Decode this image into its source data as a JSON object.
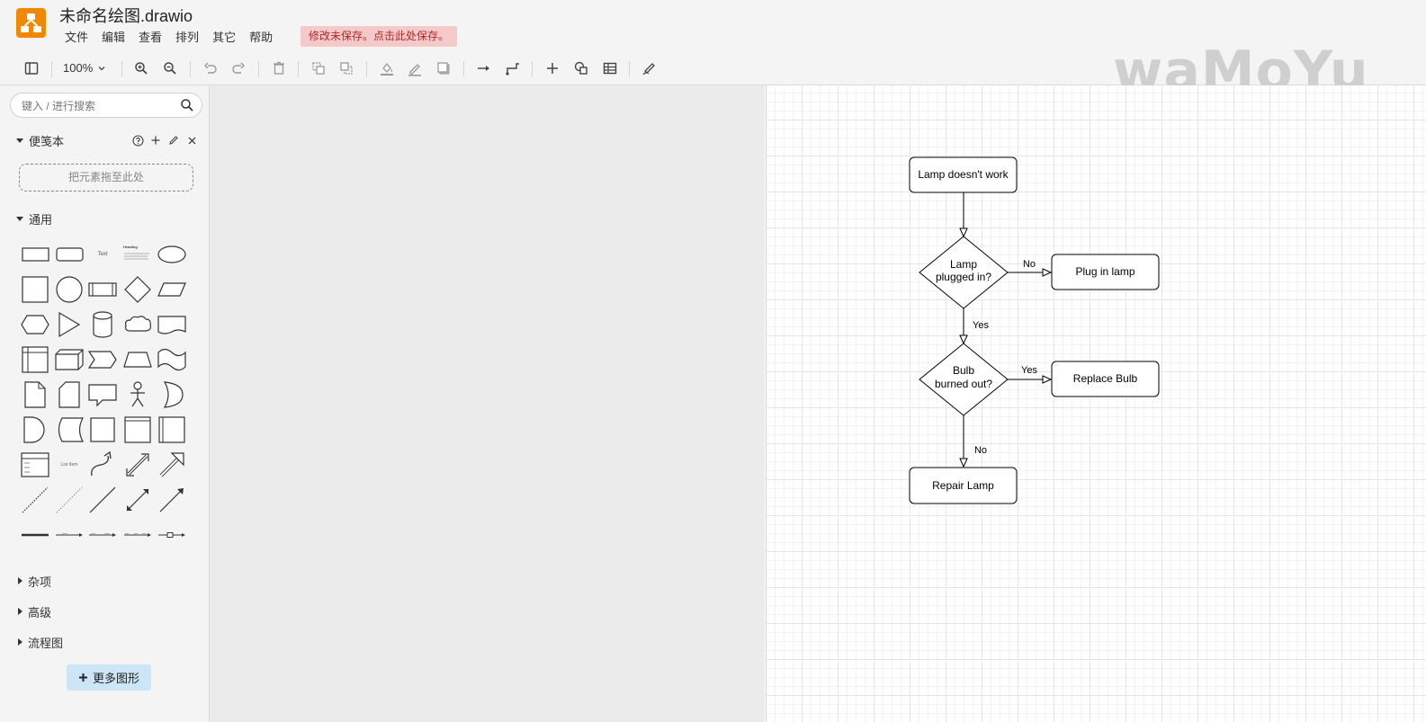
{
  "header": {
    "title": "未命名绘图.drawio",
    "menu": [
      "文件",
      "编辑",
      "查看",
      "排列",
      "其它",
      "帮助"
    ],
    "unsaved_notice": "修改未保存。点击此处保存。"
  },
  "toolbar": {
    "zoom": "100%",
    "buttons": [
      "format-panel-icon",
      "zoom-in-icon",
      "zoom-out-icon",
      "undo-icon",
      "redo-icon",
      "delete-icon",
      "to-front-icon",
      "to-back-icon",
      "fill-color-icon",
      "line-color-icon",
      "shadow-icon",
      "connection-icon",
      "waypoints-icon",
      "insert-icon",
      "shapes-icon",
      "table-icon",
      "freehand-icon"
    ]
  },
  "watermark": "waMoYu",
  "sidebar": {
    "search_placeholder": "键入 / 进行搜索",
    "scratchpad_title": "便笺本",
    "drop_zone": "把元素拖至此处",
    "general_title": "通用",
    "text_shape_label": "Text",
    "heading_shape_label": "Heading",
    "list_item_label": "List Item",
    "collapsed_sections": [
      "杂项",
      "高级",
      "流程图"
    ],
    "more_shapes": "更多图形"
  },
  "diagram": {
    "nodes": {
      "start": "Lamp doesn't work",
      "decision1_line1": "Lamp",
      "decision1_line2": "plugged in?",
      "plug": "Plug in lamp",
      "decision2_line1": "Bulb",
      "decision2_line2": "burned out?",
      "replace": "Replace Bulb",
      "repair": "Repair Lamp"
    },
    "edges": {
      "d1_no": "No",
      "d1_yes": "Yes",
      "d2_yes": "Yes",
      "d2_no": "No"
    }
  }
}
